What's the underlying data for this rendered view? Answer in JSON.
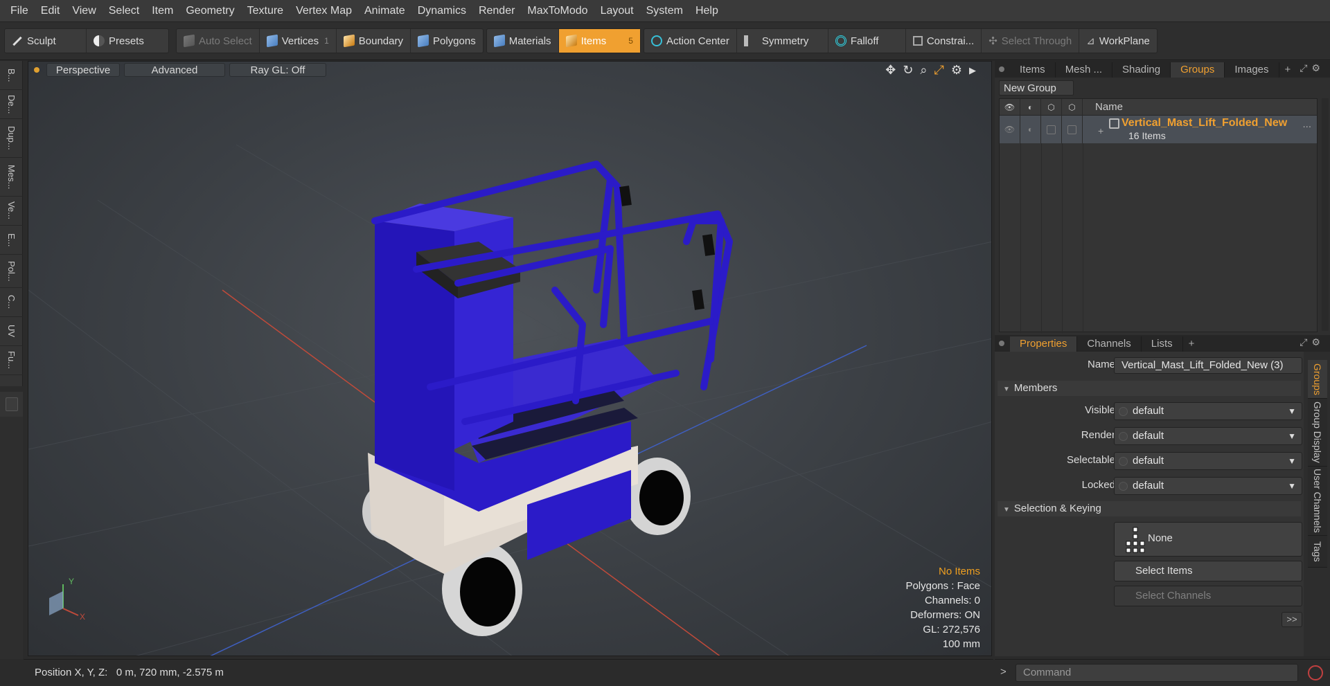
{
  "menu": [
    "File",
    "Edit",
    "View",
    "Select",
    "Item",
    "Geometry",
    "Texture",
    "Vertex Map",
    "Animate",
    "Dynamics",
    "Render",
    "MaxToModo",
    "Layout",
    "System",
    "Help"
  ],
  "toolbar": {
    "sculpt": "Sculpt",
    "presets": "Presets",
    "auto_select": "Auto Select",
    "vertices": "Vertices",
    "vertices_count": "1",
    "boundary": "Boundary",
    "polygons": "Polygons",
    "materials": "Materials",
    "items": "Items",
    "items_count": "5",
    "action_center": "Action Center",
    "symmetry": "Symmetry",
    "falloff": "Falloff",
    "constraints": "Constrai...",
    "select_through": "Select Through",
    "workplane": "WorkPlane"
  },
  "left_tabs": [
    "B...",
    "De...",
    "Dup...",
    "Mes...",
    "Ve...",
    "E...",
    "Pol...",
    "C...",
    "UV",
    "Fu..."
  ],
  "viewport": {
    "perspective": "Perspective",
    "advanced": "Advanced",
    "raygl": "Ray GL: Off",
    "stats": {
      "no_items": "No Items",
      "polygons": "Polygons : Face",
      "channels": "Channels: 0",
      "deformers": "Deformers: ON",
      "gl": "GL: 272,576",
      "scale": "100 mm"
    },
    "axis_y": "Y",
    "axis_x": "X",
    "model_color": "#2b1bc8"
  },
  "right_tabs": {
    "items": "Items",
    "mesh": "Mesh ...",
    "shading": "Shading",
    "groups": "Groups",
    "images": "Images",
    "plus": "+"
  },
  "groups": {
    "new_group": "New Group",
    "name_header": "Name",
    "row_name": "Vertical_Mast_Lift_Folded_New",
    "row_sub": "16 Items",
    "row_more": "..."
  },
  "prop_tabs": {
    "properties": "Properties",
    "channels": "Channels",
    "lists": "Lists",
    "plus": "+"
  },
  "properties": {
    "name_label": "Name",
    "name_value": "Vertical_Mast_Lift_Folded_New (3)",
    "members": "Members",
    "visible_label": "Visible",
    "visible_value": "default",
    "render_label": "Render",
    "render_value": "default",
    "selectable_label": "Selectable",
    "selectable_value": "default",
    "locked_label": "Locked",
    "locked_value": "default",
    "selection_keying": "Selection & Keying",
    "none_label": "None",
    "select_items": "Select Items",
    "select_channels": "Select Channels",
    "more": ">>"
  },
  "right_vtabs": [
    "Groups",
    "Group Display",
    "User Channels",
    "Tags"
  ],
  "status": {
    "position": "Position X, Y, Z:   0 m, 720 mm, -2.575 m"
  },
  "command": {
    "prompt": ">",
    "placeholder": "Command"
  }
}
